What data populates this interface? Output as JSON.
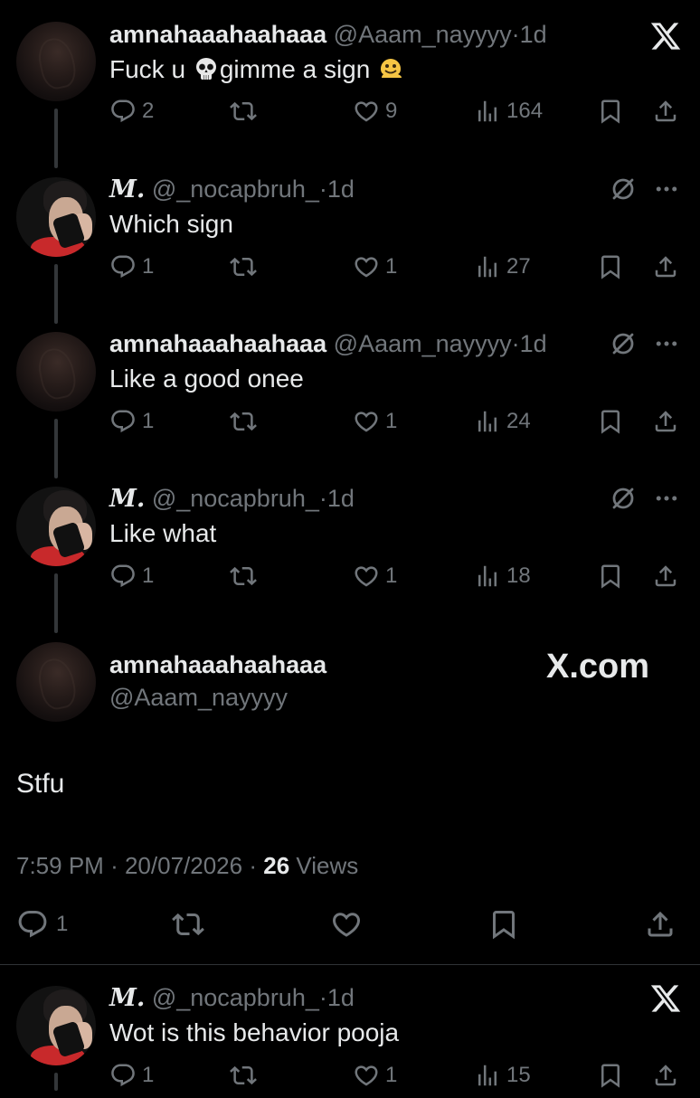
{
  "tweets": [
    {
      "name": "amnahaaahaahaaa",
      "handle": "@Aaam_nayyyy",
      "sep": "·",
      "time": "1d",
      "text_a": "Fuck u ",
      "text_b": "gimme a sign ",
      "emojis": [
        "skull-emoji",
        "melting-face-emoji"
      ],
      "replies": "2",
      "reposts": "",
      "likes": "9",
      "views": "164"
    },
    {
      "name": "M.",
      "handle": "@_nocapbruh_",
      "sep": "·",
      "time": "1d",
      "text": "Which sign",
      "replies": "1",
      "reposts": "",
      "likes": "1",
      "views": "27"
    },
    {
      "name": "amnahaaahaahaaa",
      "handle": "@Aaam_nayyyy",
      "sep": "·",
      "time": "1d",
      "text": "Like a good onee",
      "replies": "1",
      "reposts": "",
      "likes": "1",
      "views": "24"
    },
    {
      "name": "M.",
      "handle": "@_nocapbruh_",
      "sep": "·",
      "time": "1d",
      "text": "Like what",
      "replies": "1",
      "reposts": "",
      "likes": "1",
      "views": "18"
    }
  ],
  "main_tweet": {
    "name": "amnahaaahaahaaa",
    "handle": "@Aaam_nayyyy",
    "watermark": "X.com",
    "text": "Stfu",
    "time": "7:59 PM",
    "sep1": "·",
    "date": "20/07/2026",
    "sep2": "·",
    "views_count": "26",
    "views_label": " Views",
    "replies": "1"
  },
  "last_reply": {
    "name": "M.",
    "handle": "@_nocapbruh_",
    "sep": "·",
    "time": "1d",
    "text": "Wot is this behavior pooja",
    "replies": "1",
    "likes": "1",
    "views": "15"
  },
  "colors": {
    "background": "#000000",
    "text": "#e7e9ea",
    "muted": "#71767b",
    "divider": "#2f3336"
  }
}
